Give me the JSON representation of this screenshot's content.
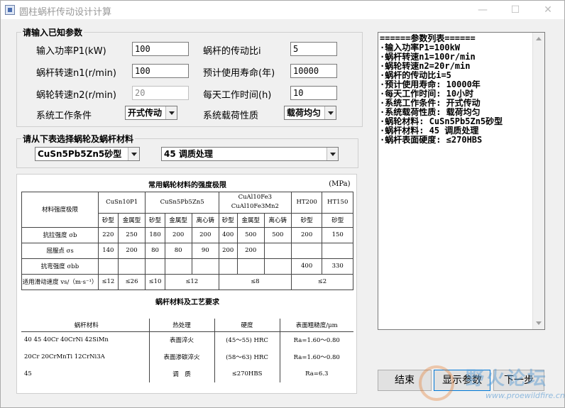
{
  "window": {
    "title": "圆柱蜗杆传动设计计算",
    "minimize": "—",
    "maximize": "☐",
    "close": "✕"
  },
  "input_group": {
    "legend": "请输入已知参数",
    "power_label": "输入功率P1(kW)",
    "power_value": "100",
    "ratio_label": "蜗杆的传动比i",
    "ratio_value": "5",
    "worm_speed_label": "蜗杆转速n1(r/min)",
    "worm_speed_value": "100",
    "life_label": "预计使用寿命(年)",
    "life_value": "10000",
    "wheel_speed_label": "蜗轮转速n2(r/min)",
    "wheel_speed_value": "20",
    "hours_label": "每天工作时间(h)",
    "hours_value": "10",
    "condition_label": "系统工作条件",
    "condition_value": "开式传动",
    "load_label": "系统载荷性质",
    "load_value": "载荷均匀"
  },
  "material_group": {
    "legend": "请从下表选择蜗轮及蜗杆材料",
    "wheel_material": "CuSn5Pb5Zn5砂型",
    "worm_material": "45 调质处理"
  },
  "strength_table": {
    "title": "常用蜗轮材料的强度极限",
    "unit": "(MPa)",
    "row_header": "材料强度极限",
    "materials": [
      "CuSn10P1",
      "CuSn5Pb5Zn5",
      "CuAl10Fe3",
      "CuAl10Fe3Mn2",
      "HT200",
      "HT150"
    ],
    "casting": [
      "砂型",
      "金属型",
      "砂型",
      "金属型",
      "离心铸",
      "砂型",
      "金属型",
      "离心铸",
      "砂型",
      "砂型"
    ],
    "rows": [
      {
        "label": "抗拉强度 σb",
        "values": [
          "220",
          "250",
          "180",
          "200",
          "200",
          "400",
          "500",
          "500",
          "200",
          "150"
        ]
      },
      {
        "label": "屈服点 σs",
        "values": [
          "140",
          "200",
          "80",
          "80",
          "90",
          "200",
          "200",
          "",
          "",
          ""
        ]
      },
      {
        "label": "抗弯强度 σbb",
        "values": [
          "",
          "",
          "",
          "",
          "",
          "",
          "",
          "",
          "400",
          "330"
        ]
      }
    ],
    "speed_label": "适用滑动速度 vs/（m·s⁻¹）",
    "speed_values": [
      "≤12",
      "≤26",
      "≤10",
      "≤12",
      "≤8",
      "≤2"
    ]
  },
  "process_table": {
    "title": "蜗杆材料及工艺要求",
    "headers": [
      "蜗杆材料",
      "热处理",
      "硬度",
      "表面粗糙度/μm"
    ],
    "rows": [
      [
        "40  45  40Cr  40CrNi  42SiMn",
        "表面淬火",
        "(45～55) HRC",
        "Ra=1.60～0.80"
      ],
      [
        "20Cr  20CrMnTi  12CrNi3A",
        "表面渗碳淬火",
        "(58～63) HRC",
        "Ra=1.60～0.80"
      ],
      [
        "45",
        "调　质",
        "≤270HBS",
        "Ra=6.3"
      ]
    ]
  },
  "param_list": {
    "items": [
      "======参数列表======",
      "·输入功率P1=100kW",
      "·蜗杆转速n1=100r/min",
      "·蜗轮转速n2=20r/min",
      "·蜗杆的传动比i=5",
      "·预计使用寿命: 10000年",
      "·每天工作时间: 10小时",
      "·系统工作条件: 开式传动",
      "·系统载荷性质: 载荷均匀",
      "·蜗轮材料: CuSn5Pb5Zn5砂型",
      "·蜗杆材料: 45 调质处理",
      "·蜗杆表面硬度: ≤270HBS"
    ]
  },
  "buttons": {
    "end": "结束",
    "show": "显示参数",
    "next": "下一步"
  },
  "watermark": {
    "text": "野火论坛",
    "url": "www.proewildfire.cn"
  }
}
